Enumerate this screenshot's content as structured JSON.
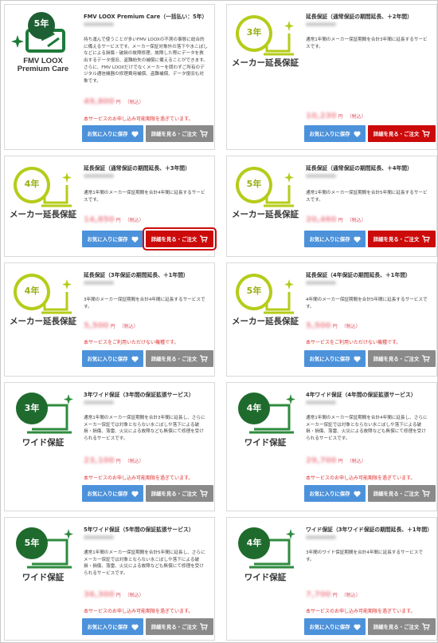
{
  "buttons": {
    "favorite": "お気に入りに保存",
    "detail": "詳細を見る・ご注文"
  },
  "colors": {
    "favorite_button": "#4c92db",
    "detail_gray": "#8a8a8a",
    "detail_red": "#cc0a0a",
    "note_red": "#e03030",
    "price_pink": "#ef8e98",
    "ext_warranty_green": "#b5cc1a",
    "wide_warranty_green": "#2e8b3e",
    "premium_green": "#1e7a3a"
  },
  "icons": {
    "laptop": "laptop-icon",
    "sparkle": "sparkle-icon",
    "heart": "heart-icon",
    "cart": "cart-icon"
  },
  "cards": [
    {
      "badge": "5年",
      "caption_line1": "FMV LOOX",
      "caption_line2": "Premium Care",
      "title": "FMV LOOX Premium Care（一括払い：5年）",
      "description": "持ち運んで使うことが多いFMV LOOXの不測の事態に総合的に備えるサービスです。メーカー保証対象外の落下や水こぼしなどによる損傷・破損の故障修理、故障した際にデータを救出するデータ復旧、盗難紛失の補償に備えることができます。さらに、FMV LOOXだけでなくメーカーを問わずご所有のデジタル通信機器の修理費用補償、盗難補償、データ復旧も対象です。",
      "price": "49,800",
      "yen": "円",
      "tax": "（税込）",
      "note": "本サービスのお申し込み可能期限を過ぎています。",
      "detail_style": "gray"
    },
    {
      "badge": "3年",
      "caption": "メーカー延長保証",
      "title": "延長保証（通常保証の期間延長、＋2年間）",
      "description": "通常1年間のメーカー保証期間を合計3年間に延長するサービスです。",
      "price": "10,230",
      "yen": "円",
      "tax": "（税込）",
      "note": "",
      "detail_style": "red"
    },
    {
      "badge": "4年",
      "caption": "メーカー延長保証",
      "title": "延長保証（通常保証の期間延長、＋3年間）",
      "description": "通常1年間のメーカー保証期間を合計4年間に延長するサービスです。",
      "price": "14,850",
      "yen": "円",
      "tax": "（税込）",
      "note": "",
      "detail_style": "red"
    },
    {
      "badge": "5年",
      "caption": "メーカー延長保証",
      "title": "延長保証（通常保証の期間延長、＋4年間）",
      "description": "通常1年間のメーカー保証期間を合計5年間に延長するサービスです。",
      "price": "20,460",
      "yen": "円",
      "tax": "（税込）",
      "note": "",
      "detail_style": "red"
    },
    {
      "badge": "4年",
      "caption": "メーカー延長保証",
      "title": "延長保証（3年保証の期間延長、＋1年間）",
      "description": "3年間のメーカー保証期間を合計4年間に延長するサービスです。",
      "price": "5,500",
      "yen": "円",
      "tax": "（税込）",
      "note": "本サービスをご利用いただけない機種です。",
      "detail_style": "gray"
    },
    {
      "badge": "5年",
      "caption": "メーカー延長保証",
      "title": "延長保証（4年保証の期間延長、＋1年間）",
      "description": "4年間のメーカー保証期間を合計5年間に延長するサービスです。",
      "price": "5,500",
      "yen": "円",
      "tax": "（税込）",
      "note": "本サービスをご利用いただけない機種です。",
      "detail_style": "gray"
    },
    {
      "badge": "3年",
      "caption": "ワイド保証",
      "title": "3年ワイド保証（3年間の保証拡張サービス）",
      "description": "通常1年間のメーカー保証期間を合計3年間に延長し、さらにメーカー保証では対象とならない水こぼしや落下による破損・損傷、落雷、火災による故障なども無償にて修理を受けられるサービスです。",
      "price": "23,100",
      "yen": "円",
      "tax": "（税込）",
      "note": "本サービスのお申し込み可能期限を過ぎています。",
      "detail_style": "gray"
    },
    {
      "badge": "4年",
      "caption": "ワイド保証",
      "title": "4年ワイド保証（4年間の保証拡張サービス）",
      "description": "通常1年間のメーカー保証期間を合計4年間に延長し、さらにメーカー保証では対象とならない水こぼしや落下による破損・損傷、落雷、火災による故障なども無償にて修理を受けられるサービスです。",
      "price": "29,700",
      "yen": "円",
      "tax": "（税込）",
      "note": "本サービスのお申し込み可能期限を過ぎています。",
      "detail_style": "gray"
    },
    {
      "badge": "5年",
      "caption": "ワイド保証",
      "title": "5年ワイド保証（5年間の保証拡張サービス）",
      "description": "通常1年間のメーカー保証期間を合計5年間に延長し、さらにメーカー保証では対象とならない水こぼしや落下による破損・損傷、落雷、火災による故障なども無償にて修理を受けられるサービスです。",
      "price": "36,300",
      "yen": "円",
      "tax": "（税込）",
      "note": "本サービスのお申し込み可能期限を過ぎています。",
      "detail_style": "gray"
    },
    {
      "badge": "4年",
      "caption": "ワイド保証",
      "title": "ワイド保証（3年ワイド保証の期間延長、＋1年間）",
      "description": "3年間のワイド保証期間を合計4年間に延長するサービスです。",
      "price": "7,700",
      "yen": "円",
      "tax": "（税込）",
      "note": "本サービスのお申し込み可能期限を過ぎています。",
      "detail_style": "gray"
    }
  ]
}
